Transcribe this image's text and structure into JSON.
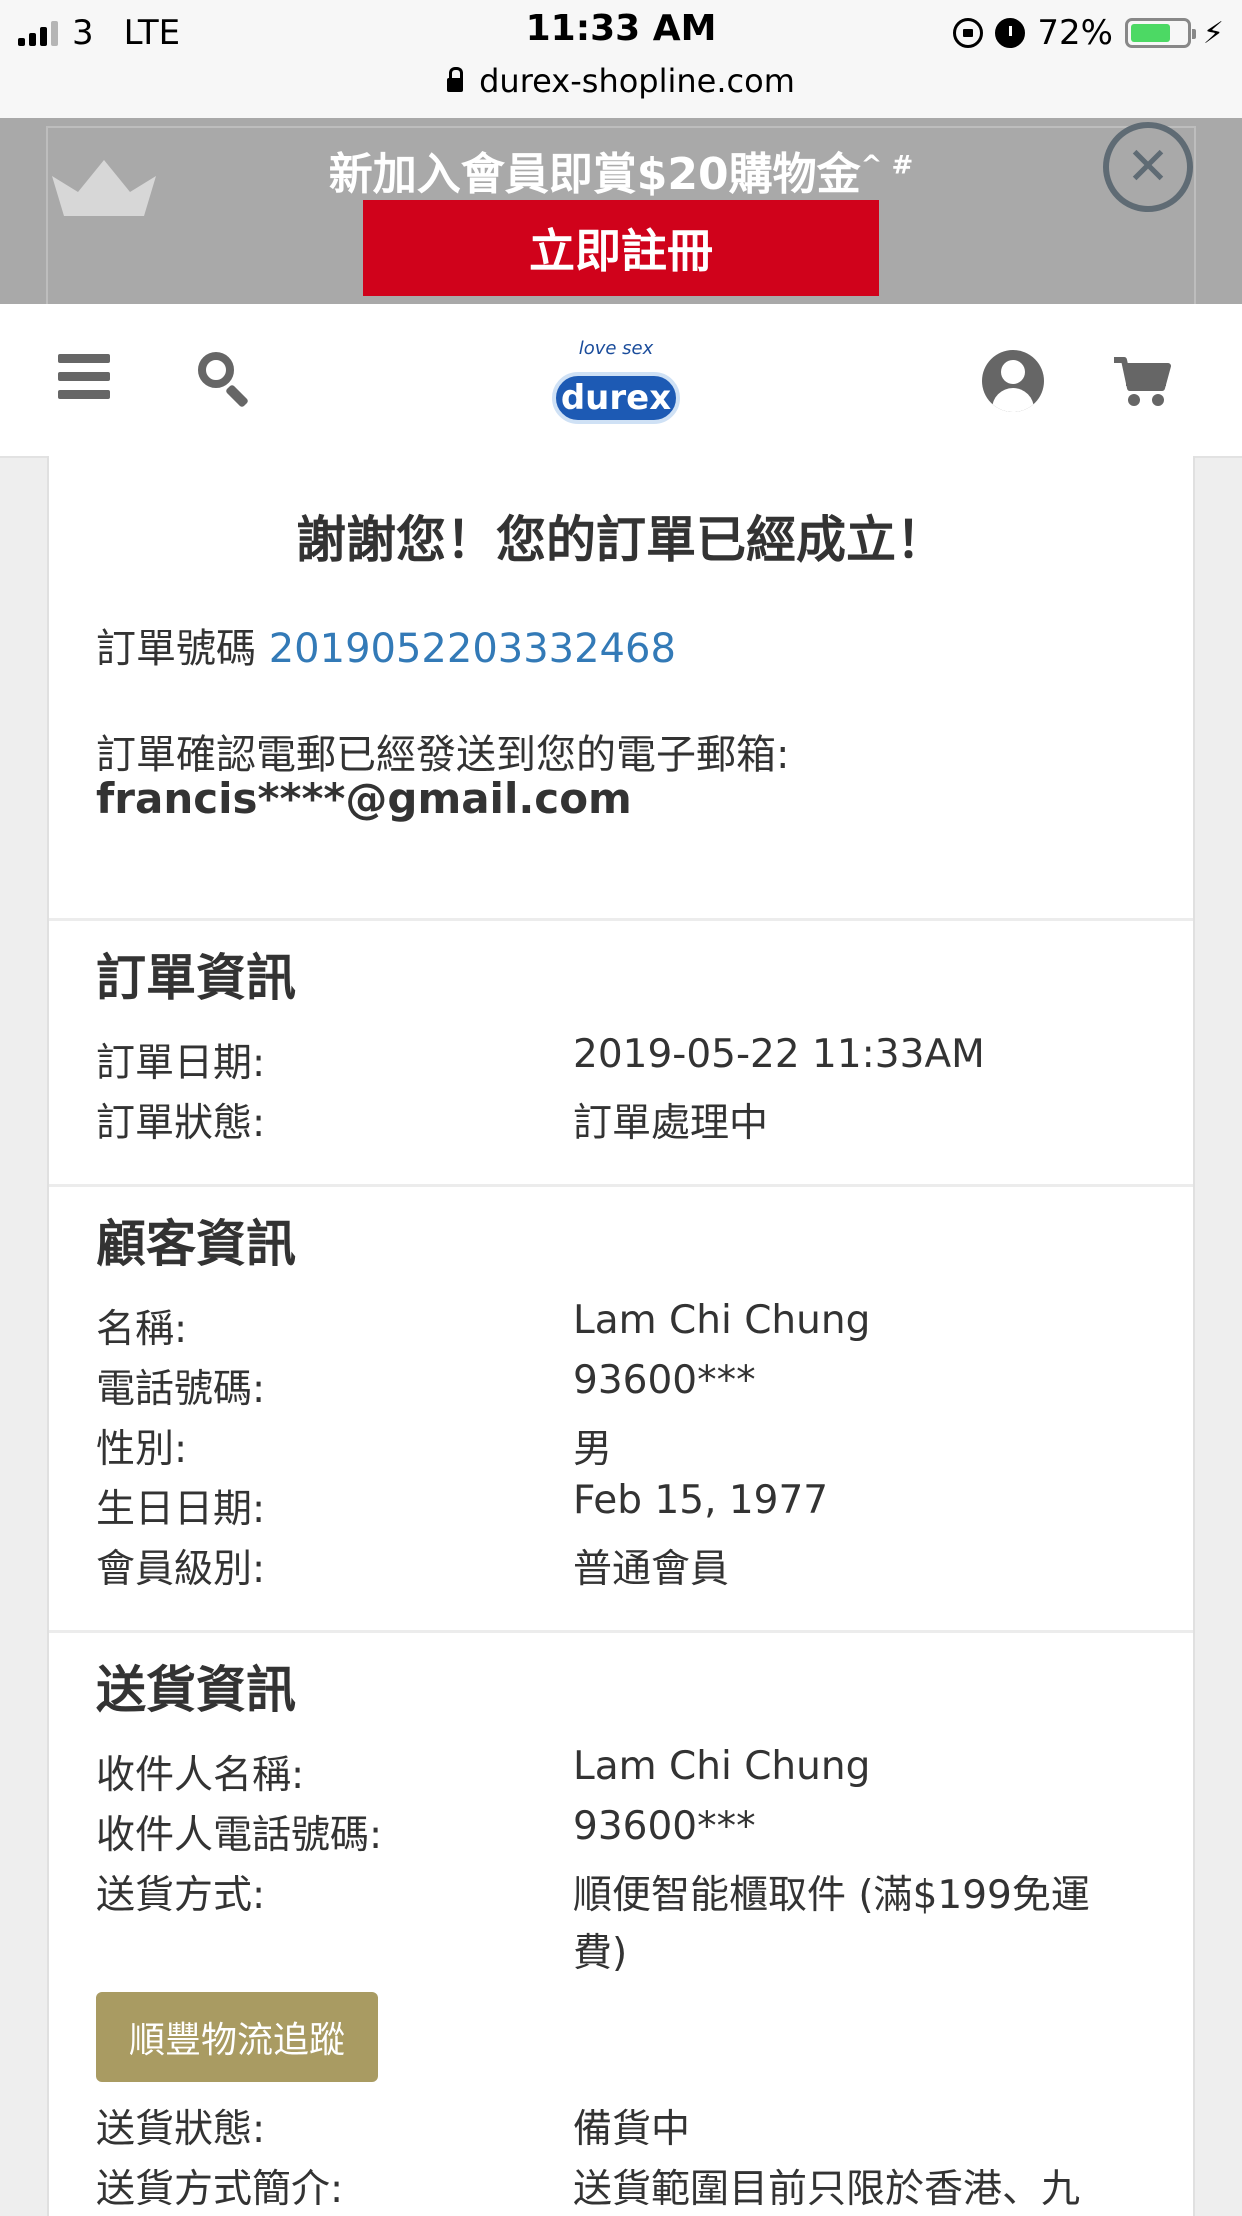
{
  "status_bar": {
    "carrier": "3",
    "network": "LTE",
    "time": "11:33 AM",
    "battery": "72%",
    "battery_level": 0.72,
    "battery_color": "#4cd964"
  },
  "browser": {
    "url": "durex-shopline.com"
  },
  "promo": {
    "title": "新加入會員即賞$20購物金",
    "title_sup": "^ #",
    "register_button": "立即註冊",
    "close_icon": "close-icon",
    "button_color": "#d0021b"
  },
  "header": {
    "logo_tagline": "love sex",
    "logo_text": "durex",
    "icons": [
      "menu-icon",
      "search-icon",
      "account-icon",
      "cart-icon"
    ]
  },
  "confirmation": {
    "heading": "謝謝您！您的訂單已經成立！",
    "order_number_label": "訂單號碼",
    "order_number": "2019052203332468",
    "email_notice": "訂單確認電郵已經發送到您的電子郵箱:",
    "email": "francis****@gmail.com"
  },
  "order_info": {
    "heading": "訂單資訊",
    "rows": [
      {
        "label": "訂單日期:",
        "value": "2019-05-22 11:33AM"
      },
      {
        "label": "訂單狀態:",
        "value": "訂單處理中"
      }
    ]
  },
  "customer_info": {
    "heading": "顧客資訊",
    "rows": [
      {
        "label": "名稱:",
        "value": "Lam Chi Chung"
      },
      {
        "label": "電話號碼:",
        "value": "93600***"
      },
      {
        "label": "性別:",
        "value": "男"
      },
      {
        "label": "生日日期:",
        "value": "Feb 15, 1977"
      },
      {
        "label": "會員級別:",
        "value": "普通會員"
      }
    ]
  },
  "delivery_info": {
    "heading": "送貨資訊",
    "rows": [
      {
        "label": "收件人名稱:",
        "value": "Lam Chi Chung"
      },
      {
        "label": "收件人電話號碼:",
        "value": "93600***"
      },
      {
        "label": "送貨方式:",
        "value": "順便智能櫃取件 (滿$199免運",
        "value_line2": "費)"
      }
    ],
    "tracking_button": "順豐物流追蹤",
    "tracking_button_color": "#a99b62",
    "rows_after": [
      {
        "label": "送貨狀態:",
        "value": "備貨中"
      },
      {
        "label": "送貨方式簡介:",
        "value": "送貨範圍目前只限於香港、九"
      }
    ]
  }
}
